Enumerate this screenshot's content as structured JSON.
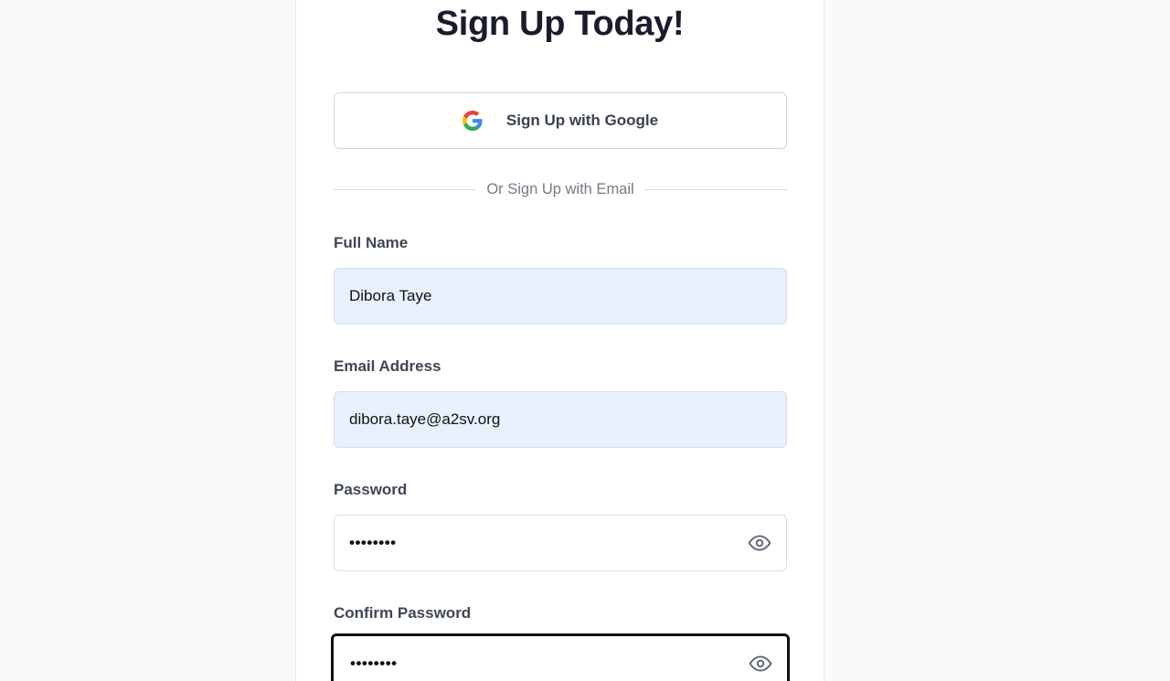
{
  "title": "Sign Up Today!",
  "google_button": {
    "label": "Sign Up with Google",
    "icon": "google-icon"
  },
  "divider_text": "Or Sign Up with Email",
  "fields": {
    "full_name": {
      "label": "Full Name",
      "value": "Dibora Taye"
    },
    "email": {
      "label": "Email Address",
      "value": "dibora.taye@a2sv.org"
    },
    "password": {
      "label": "Password",
      "masked_value": "••••••••",
      "icon": "eye-icon"
    },
    "confirm_password": {
      "label": "Confirm Password",
      "masked_value": "••••••••",
      "icon": "eye-icon"
    }
  },
  "colors": {
    "page_bg": "#f8f9fb",
    "card_bg": "#ffffff",
    "autofill_bg": "#e8f0fe",
    "title": "#1a1c2e",
    "focus_border": "#111111"
  }
}
